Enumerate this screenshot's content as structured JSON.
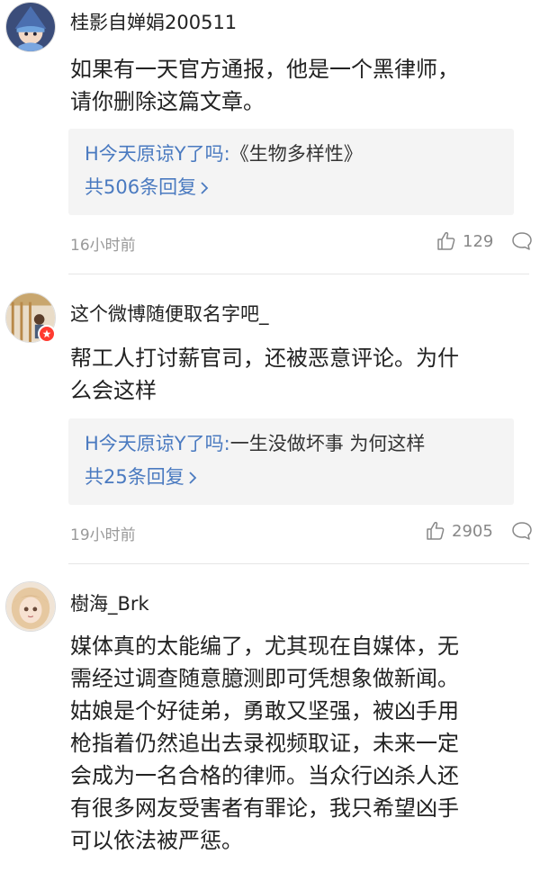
{
  "colors": {
    "link": "#4a7ac0",
    "background_reply": "#f4f4f4",
    "muted": "#999999",
    "badge_red": "#ff3b30"
  },
  "comments": [
    {
      "username": "桂影自婵娟200511",
      "avatar_icon": "wizard-avatar-icon",
      "lines": [
        "如果有一天官方通报，他是一个黑律师，",
        "请你删除这篇文章。"
      ],
      "reply": {
        "author": "H今天原谅Y了吗:",
        "text": "《生物多样性》",
        "count": "共506条回复"
      },
      "time": "16小时前",
      "likes": "129"
    },
    {
      "username": "这个微博随便取名字吧_",
      "avatar_icon": "person-avatar-icon",
      "verified_icon": "verified-badge-icon",
      "lines": [
        "帮工人打讨薪官司，还被恶意评论。为什",
        "么会这样"
      ],
      "reply": {
        "author": "H今天原谅Y了吗:",
        "text": "一生没做坏事 为何这样",
        "count": "共25条回复"
      },
      "time": "19小时前",
      "likes": "2905"
    },
    {
      "username": "樹海_Brk",
      "avatar_icon": "doll-avatar-icon",
      "lines": [
        "媒体真的太能编了，尤其现在自媒体，无",
        "需经过调查随意臆测即可凭想象做新闻。",
        "姑娘是个好徒弟，勇敢又坚强，被凶手用",
        "枪指着仍然追出去录视频取证，未来一定",
        "会成为一名合格的律师。当众行凶杀人还",
        "有很多网友受害者有罪论，我只希望凶手",
        "可以依法被严惩。"
      ]
    }
  ]
}
